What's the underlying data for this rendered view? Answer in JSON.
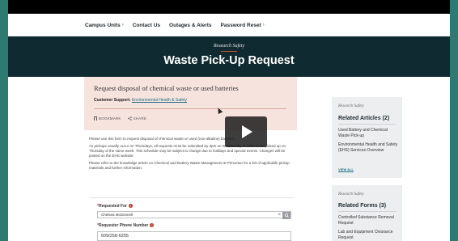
{
  "nav": {
    "items": [
      {
        "label": "Campus Units",
        "chevron": "›"
      },
      {
        "label": "Contact Us",
        "chevron": ""
      },
      {
        "label": "Outages & Alerts",
        "chevron": ""
      },
      {
        "label": "Password Reset",
        "chevron": "›"
      }
    ]
  },
  "hero": {
    "kicker": "Research Safety",
    "title": "Waste Pick-Up Request"
  },
  "alert": {
    "title": "Request disposal of chemical waste or used batteries",
    "support_label": "Customer Support:",
    "support_link": "Environmental Health & Safety",
    "bookmark_label": "BOOKMARK",
    "share_label": "SHARE"
  },
  "body": {
    "p1": "Please use this form to request disposal of chemical waste or used (non-alkaline) batteries.",
    "p2": "As pickups usually occur on Thursdays, all requests must be submitted by 3pm on Wednesday in order to be picked up on Thursday of the same week. This schedule may be subject to change due to holidays and special events. Changes will be posted on the EHS website.",
    "p3": "Please refer to the knowledge article on Chemical and Battery Waste Management at Princeton for a list of applicable pickup materials and further information."
  },
  "form": {
    "requested_for_label": "Requested For",
    "requested_for_value": "Chelsea McDonnell",
    "clear_glyph": "×",
    "phone_label": "Requester Phone Number",
    "phone_value": "609/258-6255"
  },
  "sidebar": {
    "articles": {
      "kicker": "Research Safety",
      "title": "Related Articles (2)",
      "items": [
        "Used Battery and Chemical Waste Pick-up",
        "Environmental Health and Safety (EHS) Services Overview"
      ],
      "view_all": "VIEW ALL"
    },
    "forms": {
      "kicker": "Research Safety",
      "title": "Related Forms (3)",
      "items": [
        "Controlled Substance Removal Request",
        "Lab and Equipment Clearance Request"
      ]
    }
  },
  "colors": {
    "page_bg": "#2d7a73",
    "hero_bg": "#0f2a30",
    "accent": "#c9572b",
    "alert_bg": "#f7e3de",
    "link": "#1a6e86",
    "required": "#c0392b"
  },
  "icons": [
    "bookmark-icon",
    "share-icon",
    "play-icon",
    "clear-icon",
    "search-icon",
    "required-icon",
    "chevron-right-icon"
  ]
}
